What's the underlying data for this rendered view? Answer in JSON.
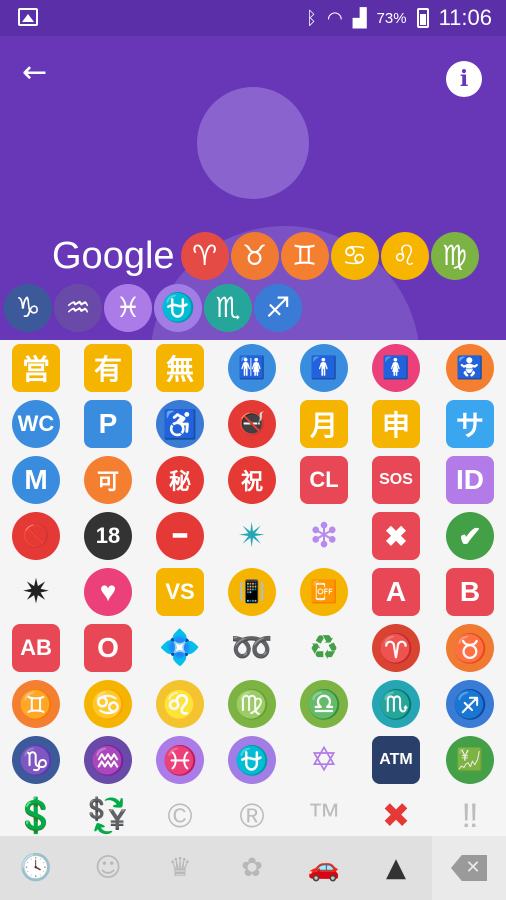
{
  "status_bar": {
    "battery_percent": "73%",
    "time": "11:06",
    "icons": [
      "gallery-icon",
      "bluetooth-icon",
      "wifi-icon",
      "signal-icon",
      "battery-icon"
    ]
  },
  "header": {
    "title": "Google",
    "bg_color": "#6737b8",
    "zodiac_row1": [
      {
        "glyph": "♈",
        "color": "#e44b45"
      },
      {
        "glyph": "♉",
        "color": "#f07a31"
      },
      {
        "glyph": "♊",
        "color": "#f57f30"
      },
      {
        "glyph": "♋",
        "color": "#f4b400"
      },
      {
        "glyph": "♌",
        "color": "#f7b500"
      },
      {
        "glyph": "♍",
        "color": "#7cb342"
      }
    ],
    "zodiac_row2": [
      {
        "glyph": "♑",
        "color": "#3c5a9a"
      },
      {
        "glyph": "♒",
        "color": "#6a4aa8"
      },
      {
        "glyph": "♓",
        "color": "#ab7be8"
      },
      {
        "glyph": "⛎",
        "color": "#a37de6"
      },
      {
        "glyph": "♏",
        "color": "#26a69a"
      },
      {
        "glyph": "♐",
        "color": "#3a7bd5"
      }
    ]
  },
  "grid": [
    [
      {
        "label": "営",
        "shape": "sq",
        "color": "#f4b400",
        "size": "t-lg"
      },
      {
        "label": "有",
        "shape": "sq",
        "color": "#f4b400",
        "size": "t-lg"
      },
      {
        "label": "無",
        "shape": "sq",
        "color": "#f4b400",
        "size": "t-lg"
      },
      {
        "label": "🚻",
        "shape": "circ",
        "color": "#3a8dde",
        "size": "t-md"
      },
      {
        "label": "🚹",
        "shape": "circ",
        "color": "#3a8dde",
        "size": "t-md"
      },
      {
        "label": "🚺",
        "shape": "circ",
        "color": "#ec407a",
        "size": "t-md"
      },
      {
        "label": "🚼",
        "shape": "circ",
        "color": "#f57f30",
        "size": "t-md"
      }
    ],
    [
      {
        "label": "WC",
        "shape": "circ",
        "color": "#3a8dde",
        "size": "t-md"
      },
      {
        "label": "P",
        "shape": "sq",
        "color": "#3a8dde",
        "size": "t-lg"
      },
      {
        "label": "♿",
        "shape": "circ",
        "color": "#3a7bd5",
        "size": "t-lg"
      },
      {
        "label": "🚭",
        "shape": "circ",
        "color": "#e53935",
        "size": "t-md"
      },
      {
        "label": "月",
        "shape": "sq",
        "color": "#f4b400",
        "size": "t-lg"
      },
      {
        "label": "申",
        "shape": "sq",
        "color": "#f4b400",
        "size": "t-lg"
      },
      {
        "label": "サ",
        "shape": "sq",
        "color": "#3aa6f0",
        "size": "t-lg"
      }
    ],
    [
      {
        "label": "M",
        "shape": "circ",
        "color": "#3a8dde",
        "size": "t-lg"
      },
      {
        "label": "可",
        "shape": "circ",
        "color": "#f57f30",
        "size": "t-md"
      },
      {
        "label": "秘",
        "shape": "circ",
        "color": "#e53935",
        "size": "t-md"
      },
      {
        "label": "祝",
        "shape": "circ",
        "color": "#e53935",
        "size": "t-md"
      },
      {
        "label": "CL",
        "shape": "sq",
        "color": "#e84855",
        "size": "t-md"
      },
      {
        "label": "SOS",
        "shape": "sq",
        "color": "#e84855",
        "size": "t-sm"
      },
      {
        "label": "ID",
        "shape": "sq",
        "color": "#b27be8",
        "size": "t-lg"
      }
    ],
    [
      {
        "label": "🚫",
        "shape": "circ",
        "color": "#e53935",
        "size": "t-md"
      },
      {
        "label": "18",
        "shape": "circ",
        "color": "#333333",
        "size": "t-md"
      },
      {
        "label": "━",
        "shape": "circ",
        "color": "#e53935",
        "size": "t-md"
      },
      {
        "label": "✴",
        "shape": "none",
        "color": "#26a6b4",
        "size": "glyph"
      },
      {
        "label": "❇",
        "shape": "none",
        "color": "#b889ee",
        "size": "glyph"
      },
      {
        "label": "✖",
        "shape": "sq",
        "color": "#e84855",
        "size": "t-lg"
      },
      {
        "label": "✔",
        "shape": "circ",
        "color": "#43a047",
        "size": "t-lg"
      }
    ],
    [
      {
        "label": "✷",
        "shape": "none",
        "color": "#222222",
        "size": "glyph"
      },
      {
        "label": "♥",
        "shape": "circ",
        "color": "#ec407a",
        "size": "t-lg"
      },
      {
        "label": "VS",
        "shape": "sq",
        "color": "#f4b400",
        "size": "t-md"
      },
      {
        "label": "📳",
        "shape": "circ",
        "color": "#f4b400",
        "size": "t-md"
      },
      {
        "label": "📴",
        "shape": "circ",
        "color": "#f4b400",
        "size": "t-md"
      },
      {
        "label": "A",
        "shape": "sq",
        "color": "#e84855",
        "size": "t-lg"
      },
      {
        "label": "B",
        "shape": "sq",
        "color": "#e84855",
        "size": "t-lg"
      }
    ],
    [
      {
        "label": "AB",
        "shape": "sq",
        "color": "#e84855",
        "size": "t-md"
      },
      {
        "label": "O",
        "shape": "sq",
        "color": "#e84855",
        "size": "t-lg"
      },
      {
        "label": "💠",
        "shape": "none",
        "color": "#5ea8e8",
        "size": "glyph"
      },
      {
        "label": "➿",
        "shape": "none",
        "color": "#777777",
        "size": "glyph"
      },
      {
        "label": "♻",
        "shape": "none",
        "color": "#43a047",
        "size": "glyph"
      },
      {
        "label": "♈",
        "shape": "circ",
        "color": "#d84332",
        "size": "t-lg"
      },
      {
        "label": "♉",
        "shape": "circ",
        "color": "#f07a31",
        "size": "t-lg"
      }
    ],
    [
      {
        "label": "♊",
        "shape": "circ",
        "color": "#f57f30",
        "size": "t-lg"
      },
      {
        "label": "♋",
        "shape": "circ",
        "color": "#f4b400",
        "size": "t-lg"
      },
      {
        "label": "♌",
        "shape": "circ",
        "color": "#f4c430",
        "size": "t-lg"
      },
      {
        "label": "♍",
        "shape": "circ",
        "color": "#7cb342",
        "size": "t-lg"
      },
      {
        "label": "♎",
        "shape": "circ",
        "color": "#7cb342",
        "size": "t-lg"
      },
      {
        "label": "♏",
        "shape": "circ",
        "color": "#26a6b4",
        "size": "t-lg"
      },
      {
        "label": "♐",
        "shape": "circ",
        "color": "#3a7bd5",
        "size": "t-lg"
      }
    ],
    [
      {
        "label": "♑",
        "shape": "circ",
        "color": "#3c5a9a",
        "size": "t-lg"
      },
      {
        "label": "♒",
        "shape": "circ",
        "color": "#6a4aa8",
        "size": "t-lg"
      },
      {
        "label": "♓",
        "shape": "circ",
        "color": "#ab7be8",
        "size": "t-lg"
      },
      {
        "label": "⛎",
        "shape": "circ",
        "color": "#a37de6",
        "size": "t-lg"
      },
      {
        "label": "✡",
        "shape": "none",
        "color": "#b27be8",
        "size": "glyph"
      },
      {
        "label": "ATM",
        "shape": "sq",
        "color": "#2a3f6a",
        "size": "t-sm"
      },
      {
        "label": "💹",
        "shape": "circ",
        "color": "#43a047",
        "size": "t-md"
      }
    ],
    [
      {
        "label": "💲",
        "shape": "none",
        "color": "#7cb342",
        "size": "glyph"
      },
      {
        "label": "💱",
        "shape": "none",
        "color": "#7cb342",
        "size": "glyph"
      },
      {
        "label": "©",
        "shape": "none",
        "color": "#bdbdbd",
        "size": "glyph"
      },
      {
        "label": "®",
        "shape": "none",
        "color": "#bdbdbd",
        "size": "glyph"
      },
      {
        "label": "™",
        "shape": "none",
        "color": "#bdbdbd",
        "size": "glyph"
      },
      {
        "label": "✖",
        "shape": "none",
        "color": "#e53935",
        "size": "glyph"
      },
      {
        "label": "‼",
        "shape": "none",
        "color": "#bdbdbd",
        "size": "glyph"
      }
    ]
  ],
  "tabs": [
    {
      "name": "recent-tab",
      "glyph": "🕓",
      "active": false
    },
    {
      "name": "smiley-tab",
      "glyph": "☺",
      "active": false
    },
    {
      "name": "objects-tab",
      "glyph": "♛",
      "active": false
    },
    {
      "name": "nature-tab",
      "glyph": "✿",
      "active": false
    },
    {
      "name": "places-tab",
      "glyph": "🚗",
      "active": false
    },
    {
      "name": "symbols-tab",
      "glyph": "▲",
      "active": true
    }
  ],
  "delete_label": "✕"
}
